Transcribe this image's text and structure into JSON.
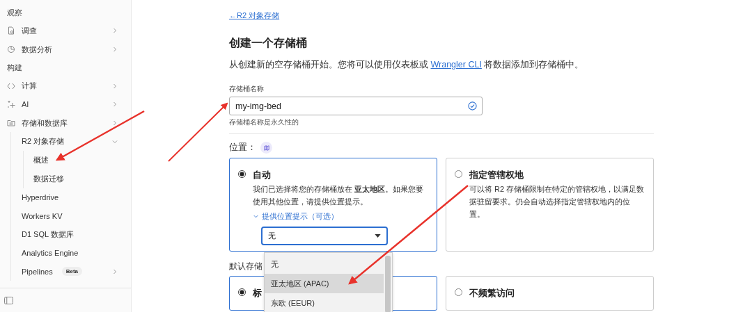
{
  "sidebar": {
    "sections": [
      {
        "title": "观察",
        "items": [
          {
            "label": "调查",
            "expanded": false
          },
          {
            "label": "数据分析",
            "expanded": false
          }
        ]
      },
      {
        "title": "构建",
        "items": [
          {
            "label": "计算",
            "expanded": false
          },
          {
            "label": "AI",
            "expanded": false
          },
          {
            "label": "存储和数据库",
            "expanded": false,
            "children": [
              {
                "label": "R2 对象存储",
                "expanded": true,
                "children": [
                  {
                    "label": "概述"
                  },
                  {
                    "label": "数据迁移"
                  }
                ]
              },
              {
                "label": "Hyperdrive"
              },
              {
                "label": "Workers KV"
              },
              {
                "label": "D1 SQL 数据库"
              },
              {
                "label": "Analytics Engine"
              },
              {
                "label": "Pipelines",
                "badge": "Beta",
                "expanded": false
              }
            ]
          }
        ]
      }
    ]
  },
  "main": {
    "back_link": "←R2 对象存储",
    "heading": "创建一个存储桶",
    "description": {
      "before": "从创建新的空存储桶开始。您将可以使用仪表板或 ",
      "link": "Wrangler CLI",
      "after": " 将数据添加到存储桶中。"
    },
    "name_field": {
      "label": "存储桶名称",
      "value": "my-img-bed",
      "valid": true,
      "help": "存储桶名称是永久性的"
    },
    "location": {
      "label": "位置：",
      "options": [
        {
          "title": "自动",
          "selected": true,
          "description": "我们已选择将您的存储桶放在 **亚太地区**。如果您要使用其他位置，请提供位置提示。",
          "hint_toggle": {
            "label": "提供位置提示（可选）",
            "expanded": true
          },
          "select": {
            "value": "无",
            "open": true,
            "options": [
              {
                "label": "无",
                "highlighted": false
              },
              {
                "label": "亚太地区 (APAC)",
                "highlighted": true
              },
              {
                "label": "东欧 (EEUR)",
                "highlighted": false
              }
            ]
          }
        },
        {
          "title": "指定管辖权地",
          "selected": false,
          "description": "可以将 R2 存储桶限制在特定的管辖权地，以满足数据驻留要求。仍会自动选择指定管辖权地内的位置。"
        }
      ]
    },
    "storage_class": {
      "label": "默认存储",
      "options": [
        {
          "title": "标",
          "selected": true
        },
        {
          "title": "不频繁访问",
          "selected": false
        }
      ]
    }
  }
}
